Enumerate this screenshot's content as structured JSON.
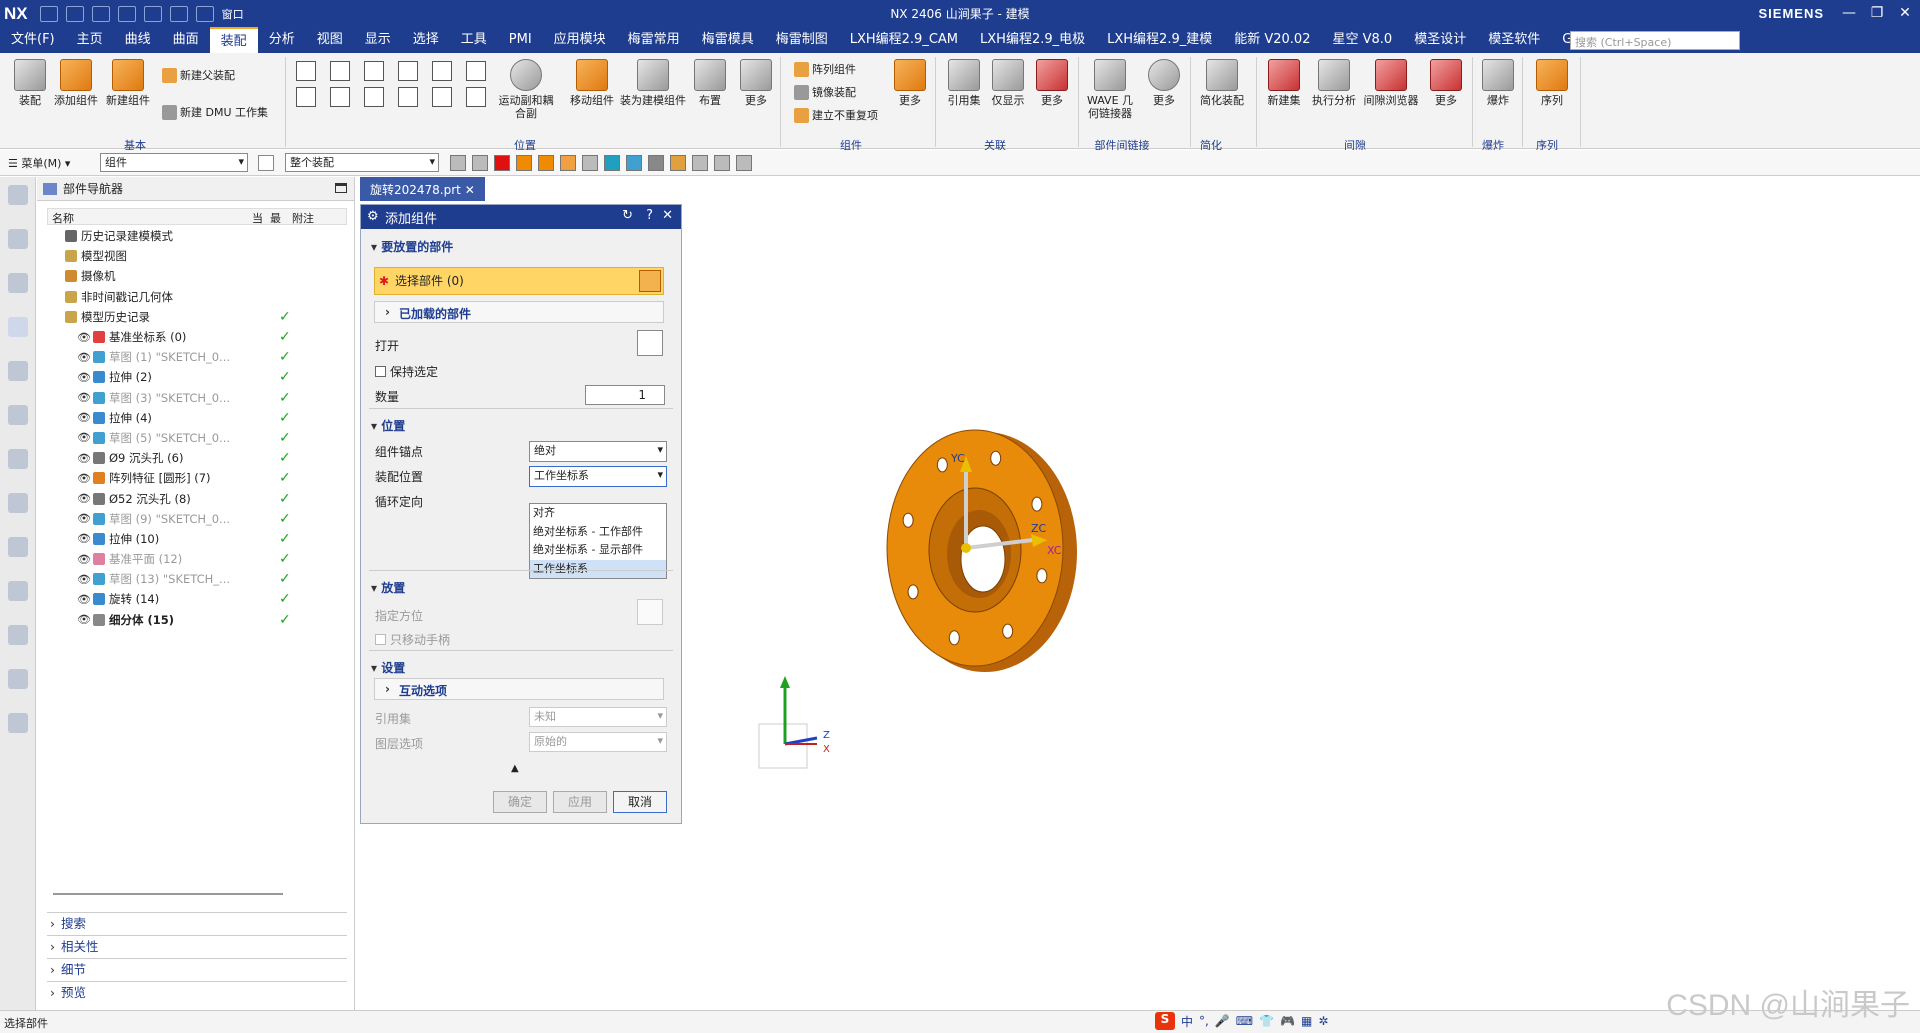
{
  "app": {
    "logo": "NX",
    "window_title": "NX 2406 山涧果子 - 建模",
    "brand": "SIEMENS",
    "window_menu": "窗口"
  },
  "menubar": {
    "items": [
      "文件(F)",
      "主页",
      "曲线",
      "曲面",
      "装配",
      "分析",
      "视图",
      "显示",
      "选择",
      "工具",
      "PMI",
      "应用模块",
      "梅雷常用",
      "梅雷模具",
      "梅雷制图",
      "LXH编程2.9_CAM",
      "LXH编程2.9_电极",
      "LXH编程2.9_建模",
      "能新 V20.02",
      "星空 V8.0",
      "模圣设计",
      "模圣软件",
      "GC工具箱"
    ],
    "active": "装配",
    "search_placeholder": "搜索 (Ctrl+Space)"
  },
  "ribbon": {
    "buttons": [
      "装配",
      "添加组件",
      "新建组件",
      "运动副和耦合副",
      "移动组件",
      "装为建模组件",
      "布置",
      "更多",
      "更多",
      "引用集",
      "仅显示",
      "更多",
      "WAVE 几何链接器",
      "更多",
      "简化装配",
      "新建集",
      "执行分析",
      "间隙浏览器",
      "更多",
      "爆炸",
      "序列"
    ],
    "small": [
      "新建父装配",
      "新建 DMU 工作集",
      "阵列组件",
      "镜像装配",
      "建立不重复项"
    ],
    "groups": [
      "基本",
      "位置",
      "组件",
      "关联",
      "部件间链接",
      "简化",
      "间隙",
      "爆炸",
      "序列"
    ]
  },
  "selection_bar": {
    "menu": "菜单(M)",
    "filter": "组件",
    "scope": "整个装配"
  },
  "navigator": {
    "title": "部件导航器",
    "columns": [
      "名称",
      "当",
      "最",
      "附注"
    ],
    "rows": [
      {
        "label": "历史记录建模模式",
        "icon": "clock-icon",
        "dim": false,
        "check": false
      },
      {
        "label": "模型视图",
        "icon": "folder-icon",
        "dim": false,
        "check": false
      },
      {
        "label": "摄像机",
        "icon": "camera-icon",
        "dim": false,
        "check": false
      },
      {
        "label": "非时间戳记几何体",
        "icon": "folder-icon",
        "dim": false,
        "check": false
      },
      {
        "label": "模型历史记录",
        "icon": "folder-icon",
        "dim": false,
        "check": true
      },
      {
        "label": "基准坐标系 (0)",
        "icon": "csys-icon",
        "dim": false,
        "check": true
      },
      {
        "label": "草图 (1) \"SKETCH_0...",
        "icon": "sketch-icon",
        "dim": true,
        "check": true
      },
      {
        "label": "拉伸 (2)",
        "icon": "extrude-icon",
        "dim": false,
        "check": true
      },
      {
        "label": "草图 (3) \"SKETCH_0...",
        "icon": "sketch-icon",
        "dim": true,
        "check": true
      },
      {
        "label": "拉伸 (4)",
        "icon": "extrude-icon",
        "dim": false,
        "check": true
      },
      {
        "label": "草图 (5) \"SKETCH_0...",
        "icon": "sketch-icon",
        "dim": true,
        "check": true
      },
      {
        "label": "Ø9 沉头孔 (6)",
        "icon": "hole-icon",
        "dim": false,
        "check": true
      },
      {
        "label": "阵列特征 [圆形] (7)",
        "icon": "pattern-icon",
        "dim": false,
        "check": true
      },
      {
        "label": "Ø52 沉头孔 (8)",
        "icon": "hole-icon",
        "dim": false,
        "check": true
      },
      {
        "label": "草图 (9) \"SKETCH_0...",
        "icon": "sketch-icon",
        "dim": true,
        "check": true
      },
      {
        "label": "拉伸 (10)",
        "icon": "extrude-icon",
        "dim": false,
        "check": true
      },
      {
        "label": "基准平面 (12)",
        "icon": "plane-icon",
        "dim": true,
        "check": true
      },
      {
        "label": "草图 (13) \"SKETCH_...",
        "icon": "sketch-icon",
        "dim": true,
        "check": true
      },
      {
        "label": "旋转 (14)",
        "icon": "revolve-icon",
        "dim": false,
        "check": true
      },
      {
        "label": "细分体 (15)",
        "icon": "body-icon",
        "dim": false,
        "check": true
      }
    ],
    "bottom_panels": [
      "搜索",
      "相关性",
      "细节",
      "预览"
    ]
  },
  "tab": {
    "file": "旋转202478.prt"
  },
  "dialog": {
    "title": "添加组件",
    "sec_part": "要放置的部件",
    "select_part": "选择部件 (0)",
    "loaded_parts": "已加载的部件",
    "open": "打开",
    "keep_selected": "保持选定",
    "quantity_label": "数量",
    "quantity": "1",
    "sec_position": "位置",
    "anchor_label": "组件锚点",
    "anchor_value": "绝对",
    "assembly_pos_label": "装配位置",
    "assembly_pos_value": "工作坐标系",
    "cycle_label": "循环定向",
    "dropdown_options": [
      "对齐",
      "绝对坐标系 - 工作部件",
      "绝对坐标系 - 显示部件",
      "工作坐标系"
    ],
    "sec_place": "放置",
    "orient_label": "指定方位",
    "only_handle": "只移动手柄",
    "sec_settings": "设置",
    "interactive": "互动选项",
    "refset_label": "引用集",
    "refset_value": "未知",
    "layer_label": "图层选项",
    "layer_value": "原始的",
    "ok": "确定",
    "apply": "应用",
    "cancel": "取消"
  },
  "viewport": {
    "axis_labels": [
      "YC",
      "ZC",
      "XC"
    ],
    "triad_labels": [
      "Z",
      "X"
    ],
    "part_color": "#e88a0a"
  },
  "statusbar": {
    "prompt": "选择部件",
    "ime": [
      "中",
      "°,",
      "🎤",
      "⌨",
      "👕",
      "🎮",
      "▦",
      "✲"
    ]
  },
  "watermark": "CSDN @山涧果子",
  "colors": {
    "accent": "#1e3d8f",
    "highlight": "#ffd666",
    "check": "#1aa51a"
  }
}
